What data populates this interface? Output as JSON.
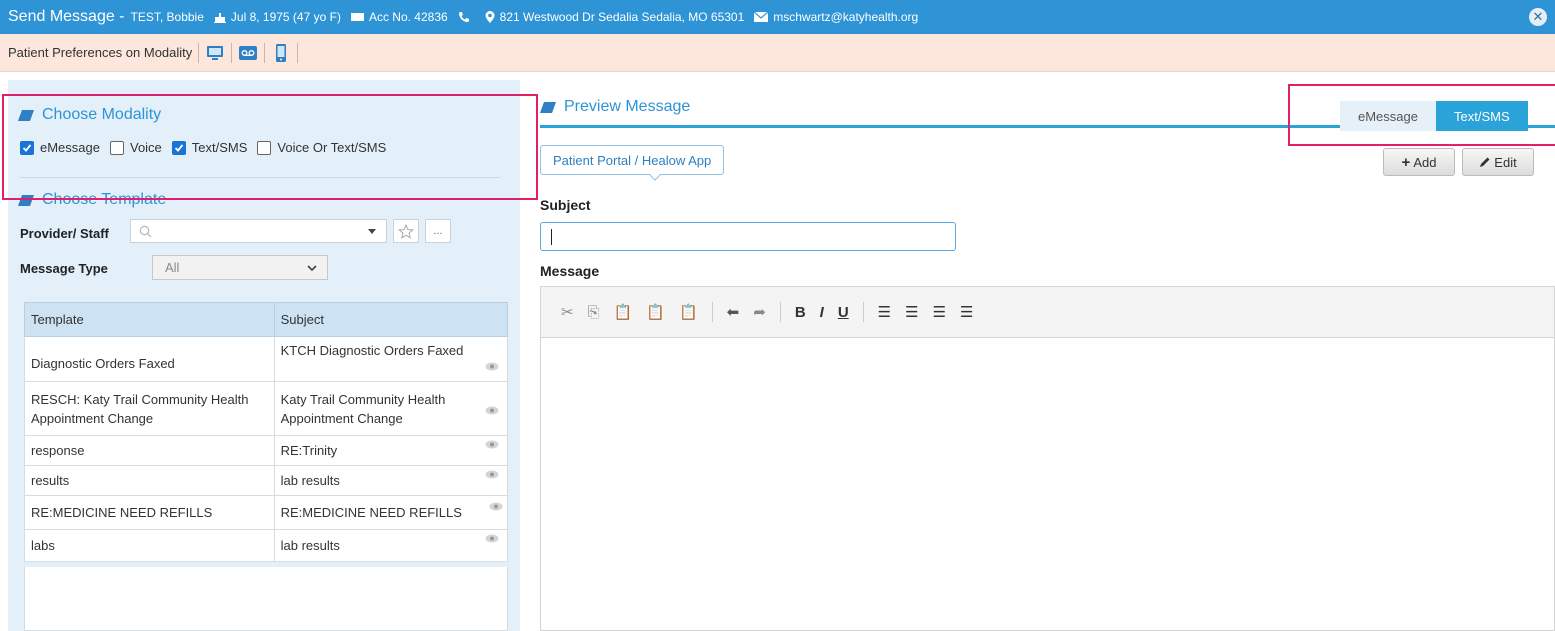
{
  "header": {
    "title": "Send Message -",
    "patient_name": "TEST, Bobbie",
    "dob": "Jul 8, 1975 (47 yo F)",
    "acc_no": "Acc No. 42836",
    "address": "821 Westwood Dr Sedalia Sedalia, MO 65301",
    "email": "mschwartz@katyhealth.org",
    "close_symbol": "✕"
  },
  "preferences_bar": {
    "label": "Patient Preferences on Modality"
  },
  "modality": {
    "heading": "Choose Modality",
    "options": [
      {
        "label": "eMessage",
        "checked": true
      },
      {
        "label": "Voice",
        "checked": false
      },
      {
        "label": "Text/SMS",
        "checked": true
      },
      {
        "label": "Voice Or Text/SMS",
        "checked": false
      }
    ]
  },
  "template_section": {
    "heading": "Choose Template",
    "provider_label": "Provider/ Staff",
    "provider_value": "",
    "more_label": "...",
    "message_type_label": "Message Type",
    "message_type_value": "All",
    "columns": [
      "Template",
      "Subject"
    ],
    "rows": [
      {
        "template": "Diagnostic Orders Faxed",
        "subject": "KTCH Diagnostic Orders Faxed"
      },
      {
        "template": "RESCH: Katy Trail Community Health Appointment Change",
        "subject": "Katy Trail Community Health Appointment Change"
      },
      {
        "template": "response",
        "subject": "RE:Trinity"
      },
      {
        "template": "results",
        "subject": "lab results"
      },
      {
        "template": "RE:MEDICINE NEED REFILLS",
        "subject": "RE:MEDICINE NEED REFILLS"
      },
      {
        "template": "labs",
        "subject": "lab results"
      }
    ]
  },
  "preview": {
    "heading": "Preview Message",
    "tabs": [
      {
        "label": "eMessage",
        "active": false
      },
      {
        "label": "Text/SMS",
        "active": true
      }
    ],
    "portal_button": "Patient Portal / Healow App",
    "add_button": "Add",
    "edit_button": "Edit",
    "subject_label": "Subject",
    "subject_value": "",
    "message_label": "Message",
    "message_value": ""
  },
  "colors": {
    "header_bg": "#2e94d6",
    "highlight": "#e0206a",
    "pref_bar_bg": "#fde7dc",
    "left_panel_bg": "#e3f0fa",
    "accent": "#2e94d6"
  }
}
